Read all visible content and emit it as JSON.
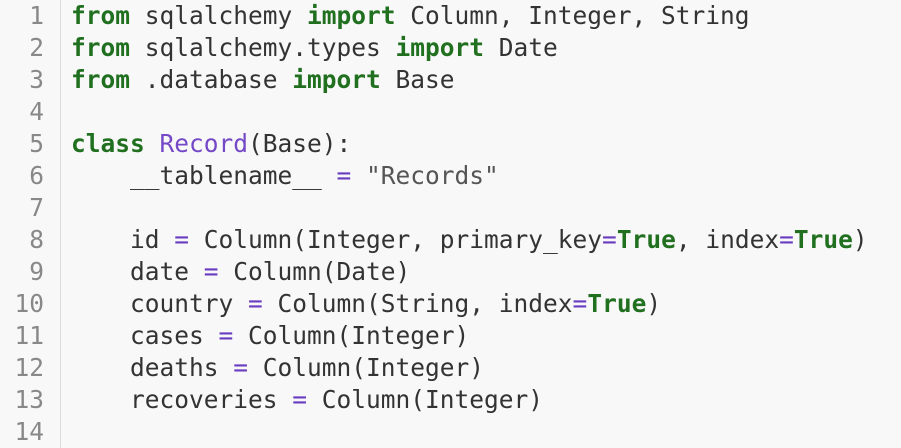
{
  "lines": [
    {
      "number": "1",
      "tokens": [
        {
          "t": "from",
          "c": "kw"
        },
        {
          "t": " sqlalchemy ",
          "c": ""
        },
        {
          "t": "import",
          "c": "kw"
        },
        {
          "t": " Column, Integer, String",
          "c": ""
        }
      ]
    },
    {
      "number": "2",
      "tokens": [
        {
          "t": "from",
          "c": "kw"
        },
        {
          "t": " sqlalchemy.types ",
          "c": ""
        },
        {
          "t": "import",
          "c": "kw"
        },
        {
          "t": " Date",
          "c": ""
        }
      ]
    },
    {
      "number": "3",
      "tokens": [
        {
          "t": "from",
          "c": "kw"
        },
        {
          "t": " .database ",
          "c": ""
        },
        {
          "t": "import",
          "c": "kw"
        },
        {
          "t": " Base",
          "c": ""
        }
      ]
    },
    {
      "number": "4",
      "tokens": []
    },
    {
      "number": "5",
      "tokens": [
        {
          "t": "class",
          "c": "kw"
        },
        {
          "t": " ",
          "c": ""
        },
        {
          "t": "Record",
          "c": "cls"
        },
        {
          "t": "(Base):",
          "c": ""
        }
      ]
    },
    {
      "number": "6",
      "tokens": [
        {
          "t": "    __tablename__ ",
          "c": ""
        },
        {
          "t": "=",
          "c": "op"
        },
        {
          "t": " ",
          "c": ""
        },
        {
          "t": "\"Records\"",
          "c": "str"
        }
      ]
    },
    {
      "number": "7",
      "tokens": []
    },
    {
      "number": "8",
      "tokens": [
        {
          "t": "    id ",
          "c": ""
        },
        {
          "t": "=",
          "c": "op"
        },
        {
          "t": " Column(Integer, primary_key",
          "c": ""
        },
        {
          "t": "=",
          "c": "op"
        },
        {
          "t": "True",
          "c": "bool"
        },
        {
          "t": ", index",
          "c": ""
        },
        {
          "t": "=",
          "c": "op"
        },
        {
          "t": "True",
          "c": "bool"
        },
        {
          "t": ")",
          "c": ""
        }
      ]
    },
    {
      "number": "9",
      "tokens": [
        {
          "t": "    date ",
          "c": ""
        },
        {
          "t": "=",
          "c": "op"
        },
        {
          "t": " Column(Date)",
          "c": ""
        }
      ]
    },
    {
      "number": "10",
      "tokens": [
        {
          "t": "    country ",
          "c": ""
        },
        {
          "t": "=",
          "c": "op"
        },
        {
          "t": " Column(String, index",
          "c": ""
        },
        {
          "t": "=",
          "c": "op"
        },
        {
          "t": "True",
          "c": "bool"
        },
        {
          "t": ")",
          "c": ""
        }
      ]
    },
    {
      "number": "11",
      "tokens": [
        {
          "t": "    cases ",
          "c": ""
        },
        {
          "t": "=",
          "c": "op"
        },
        {
          "t": " Column(Integer)",
          "c": ""
        }
      ]
    },
    {
      "number": "12",
      "tokens": [
        {
          "t": "    deaths ",
          "c": ""
        },
        {
          "t": "=",
          "c": "op"
        },
        {
          "t": " Column(Integer)",
          "c": ""
        }
      ]
    },
    {
      "number": "13",
      "tokens": [
        {
          "t": "    recoveries ",
          "c": ""
        },
        {
          "t": "=",
          "c": "op"
        },
        {
          "t": " Column(Integer)",
          "c": ""
        }
      ]
    },
    {
      "number": "14",
      "tokens": []
    }
  ],
  "colors": {
    "keyword": "#207020",
    "class_name": "#7548c7",
    "operator": "#6a3cc0",
    "string": "#555555",
    "line_number": "#888888",
    "background": "#f8f8f8"
  }
}
